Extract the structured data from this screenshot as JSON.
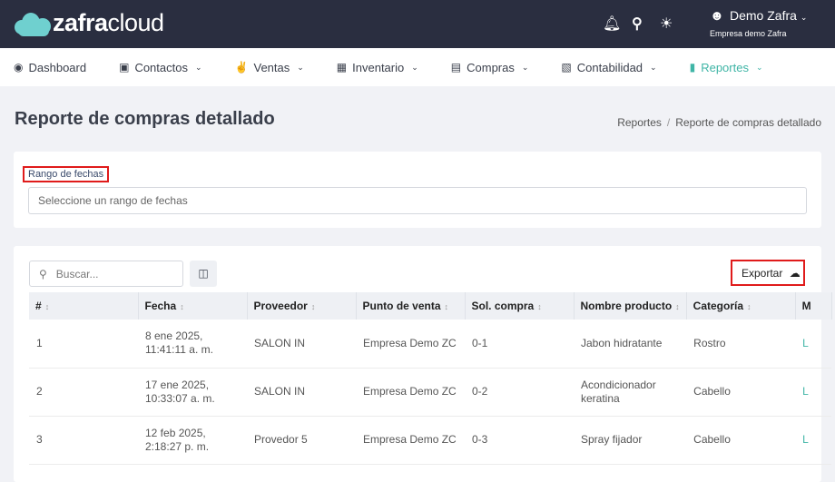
{
  "header": {
    "logo_bold": "zafra",
    "logo_light": "cloud",
    "user_name": "Demo Zafra",
    "company": "Empresa demo Zafra"
  },
  "nav": [
    {
      "label": "Dashboard",
      "icon": "dashboard-icon"
    },
    {
      "label": "Contactos",
      "icon": "contacts-icon"
    },
    {
      "label": "Ventas",
      "icon": "sales-icon"
    },
    {
      "label": "Inventario",
      "icon": "inventory-icon"
    },
    {
      "label": "Compras",
      "icon": "store-icon"
    },
    {
      "label": "Contabilidad",
      "icon": "calculator-icon"
    },
    {
      "label": "Reportes",
      "icon": "chart-icon",
      "active": true
    }
  ],
  "page": {
    "title": "Reporte de compras detallado",
    "breadcrumb": [
      "Reportes",
      "Reporte de compras detallado"
    ]
  },
  "filter": {
    "label": "Rango de fechas",
    "placeholder": "Seleccione un rango de fechas"
  },
  "toolbar": {
    "search_placeholder": "Buscar...",
    "export_label": "Exportar"
  },
  "accent": "#3fb5a6",
  "table": {
    "columns": [
      "#",
      "Fecha",
      "Proveedor",
      "Punto de venta",
      "Sol. compra",
      "Nombre producto",
      "Categoría",
      "M"
    ],
    "rows": [
      [
        "1",
        "8 ene 2025, 11:41:11 a. m.",
        "SALON IN",
        "Empresa Demo ZC",
        "0-1",
        "Jabon hidratante",
        "Rostro",
        "L"
      ],
      [
        "2",
        "17 ene 2025, 10:33:07 a. m.",
        "SALON IN",
        "Empresa Demo ZC",
        "0-2",
        "Acondicionador keratina",
        "Cabello",
        "L"
      ],
      [
        "3",
        "12 feb 2025, 2:18:27 p. m.",
        "Provedor 5",
        "Empresa Demo ZC",
        "0-3",
        "Spray fijador",
        "Cabello",
        "L"
      ]
    ]
  }
}
